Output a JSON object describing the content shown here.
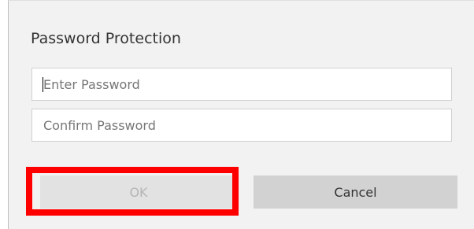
{
  "dialog": {
    "title": "Password Protection",
    "password_field": {
      "value": "",
      "placeholder": "Enter Password"
    },
    "confirm_field": {
      "value": "",
      "placeholder": "Confirm Password"
    },
    "ok_label": "OK",
    "cancel_label": "Cancel",
    "ok_enabled": false
  },
  "colors": {
    "highlight": "#ff0000",
    "ok_disabled_bg": "#e2e2e2",
    "cancel_bg": "#d2d2d2"
  }
}
